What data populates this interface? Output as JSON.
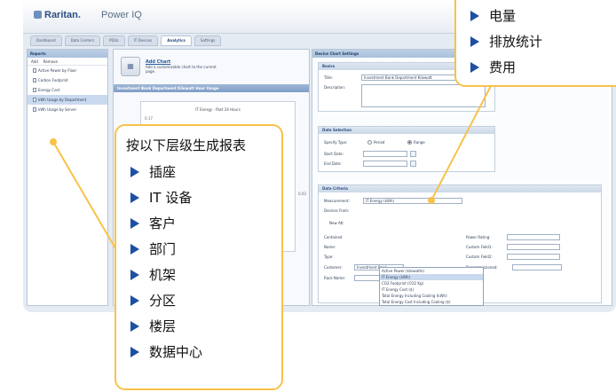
{
  "app": {
    "logo": "Raritan.",
    "product": "Power IQ"
  },
  "tabs": [
    "Dashboard",
    "Data Centers",
    "PDUs",
    "IT Devices",
    "Analytics",
    "Settings"
  ],
  "sidebar": {
    "title": "Reports",
    "add_label": "Add",
    "remove_label": "Remove",
    "items": [
      "Active Power by Floor",
      "Carbon Footprint",
      "Energy Cost",
      "kWh Usage by Department",
      "kWh Usage by Server"
    ]
  },
  "report": {
    "add_chart_link": "Add Chart",
    "add_chart_desc": "Add a customizable chart to the current page.",
    "bar_title": "Investment Bank Department Kilowatt Hour Usage",
    "chart_title": "IT Energy - Past 24 Hours",
    "y_value": "0.17",
    "side_value": "0.03"
  },
  "settings": {
    "panel_title": "Device Chart Settings",
    "basics_title": "Basics",
    "title_label": "Title:",
    "title_value": "Investment Bank Department Kilowatt",
    "description_label": "Description:",
    "date_title": "Date Selection",
    "specify_label": "Specify Type:",
    "period_label": "Period",
    "range_label": "Range",
    "start_label": "Start Date:",
    "end_label": "End Date:",
    "data_title": "Data Criteria",
    "measurement_label": "Measurement:",
    "measurement_value": "IT Energy (kWh)",
    "devices_label": "Devices From:",
    "new_label": "New Att",
    "contained_label": "Contained",
    "name_label": "Name:",
    "type_label": "Type:",
    "customer_label": "Customer:",
    "customer_value": "Investment Bank",
    "rack_label": "Rack Name:",
    "power_rating_label": "Power Rating:",
    "custom1_label": "Custom Field1:",
    "custom2_label": "Custom Field2:",
    "decommissioned_label": "Decommissioned:",
    "options": [
      "Active Power (kilowatts)",
      "IT Energy (kWh)",
      "CO2 Footprint (CO2 Kg)",
      "IT Energy Cost ($)",
      "Total Energy Including Cooling (kWh)",
      "Total Energy Cost Including Cooling ($)"
    ]
  },
  "callout_top": {
    "items": [
      "电量",
      "排放统计",
      "费用"
    ]
  },
  "callout_left": {
    "heading": "按以下层级生成报表",
    "items": [
      "插座",
      "IT 设备",
      "客户",
      "部门",
      "机架",
      "分区",
      "楼层",
      "数据中心"
    ]
  },
  "colors": {
    "callout_border": "#f7c24a",
    "arrow": "#1f4fa3"
  }
}
